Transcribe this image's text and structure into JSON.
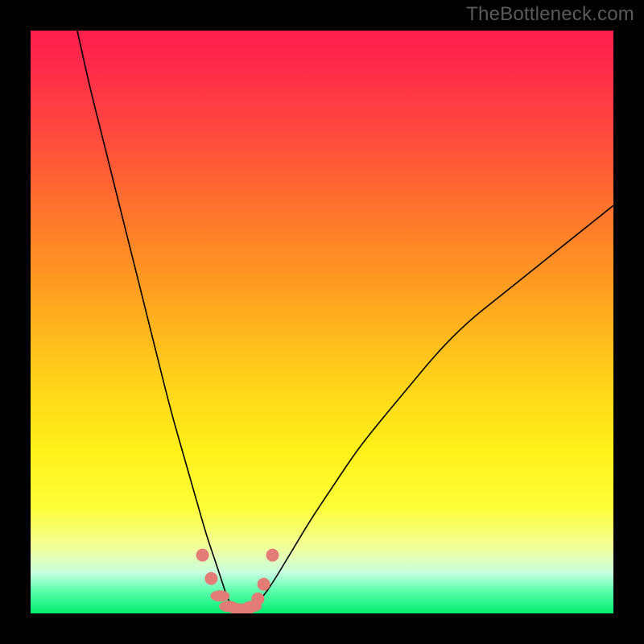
{
  "watermark": {
    "text": "TheBottleneck.com"
  },
  "colors": {
    "frame": "#000000",
    "curve_stroke": "#000000",
    "marker_fill": "#e37b77",
    "marker_stroke": "#c85f5b",
    "gradient_stops": [
      "#ff1f4e",
      "#ff2a4a",
      "#ff4a3e",
      "#ff7a2a",
      "#ffaa1f",
      "#ffd21a",
      "#fff01a",
      "#fdff3a",
      "#f0ffa0",
      "#c8ffe0",
      "#60ffb0",
      "#00ec6e"
    ]
  },
  "chart_data": {
    "type": "line",
    "title": "",
    "xlabel": "",
    "ylabel": "",
    "xlim": [
      0,
      100
    ],
    "ylim": [
      0,
      100
    ],
    "note": "V-shaped bottleneck curve over red→green vertical gradient; minimum sits near x≈34, y≈0. Left branch rises steeply toward y≈100 at x≈8; right branch rises with diminishing slope toward y≈70 at x=100. Salmon marker dots cluster around the trough.",
    "series": [
      {
        "name": "curve",
        "x": [
          8,
          10,
          12,
          14,
          16,
          18,
          20,
          22,
          24,
          26,
          28,
          30,
          31,
          32,
          33,
          34,
          35,
          36,
          37,
          38,
          40,
          42,
          45,
          48,
          52,
          56,
          60,
          65,
          70,
          75,
          80,
          85,
          90,
          95,
          100
        ],
        "y": [
          100,
          91,
          83,
          75,
          67,
          59,
          51,
          43,
          35,
          28,
          21,
          14,
          11,
          8,
          5,
          2,
          1,
          0.5,
          0.5,
          1,
          3,
          6,
          11,
          16,
          22,
          28,
          33,
          39,
          45,
          50,
          54,
          58,
          62,
          66,
          70
        ]
      }
    ],
    "markers": {
      "name": "trough-dots",
      "x": [
        29.5,
        31,
        32.5,
        34,
        35.5,
        37,
        38,
        39,
        40,
        41.5
      ],
      "y": [
        10,
        6,
        3,
        1.2,
        0.8,
        0.8,
        1.2,
        2.5,
        5,
        10
      ]
    }
  }
}
